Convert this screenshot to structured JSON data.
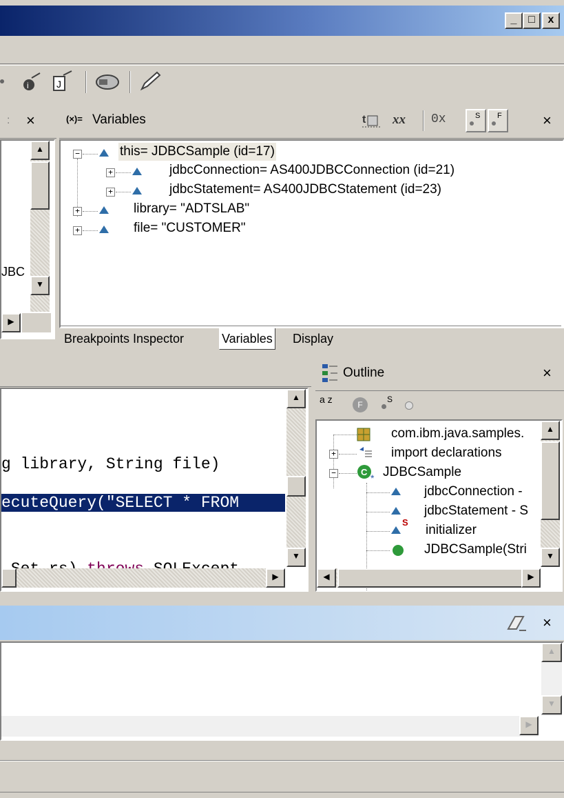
{
  "window": {
    "minimize": "_",
    "maximize": "□",
    "close": "x"
  },
  "variables_view": {
    "title": "Variables",
    "toolbar_icons": [
      "show-types-icon",
      "show-qualified-names-icon",
      "hex-icon",
      "static-fields-icon",
      "final-fields-icon"
    ],
    "hex_label": "0x",
    "rows": [
      {
        "text": "this= JDBCSample  (id=17)",
        "expander": "−"
      },
      {
        "text": "jdbcConnection= AS400JDBCConnection  (id=21)",
        "expander": "+"
      },
      {
        "text": "jdbcStatement= AS400JDBCStatement  (id=23)",
        "expander": "+"
      },
      {
        "text": "library= \"ADTSLAB\"",
        "expander": "+"
      },
      {
        "text": "file= \"CUSTOMER\"",
        "expander": "+"
      }
    ],
    "tabs": [
      "Breakpoints",
      "Inspector",
      "Variables",
      "Display"
    ],
    "active_tab": "Variables"
  },
  "left_pane": {
    "clipped_text": "JBC"
  },
  "editor": {
    "line1": "g library, String file)",
    "line2": "ecuteQuery(\"SELECT * FROM",
    "line3_pre": ".Set rs) ",
    "line3_kw": "throws",
    "line3_post": " SQLExcept"
  },
  "outline": {
    "title": "Outline",
    "items": [
      {
        "text": "com.ibm.java.samples."
      },
      {
        "text": "import declarations"
      },
      {
        "text": "JDBCSample"
      },
      {
        "text": "jdbcConnection -"
      },
      {
        "text": "jdbcStatement - S"
      },
      {
        "text": "initializer",
        "badge": "S"
      },
      {
        "text": "JDBCSample(Stri"
      }
    ],
    "sort_label": "a z",
    "toolbar_s": "S"
  },
  "colors": {
    "selection": "#0a246a",
    "keyword": "#7f0055",
    "title_start": "#0a246a",
    "title_end": "#a6caf0"
  }
}
